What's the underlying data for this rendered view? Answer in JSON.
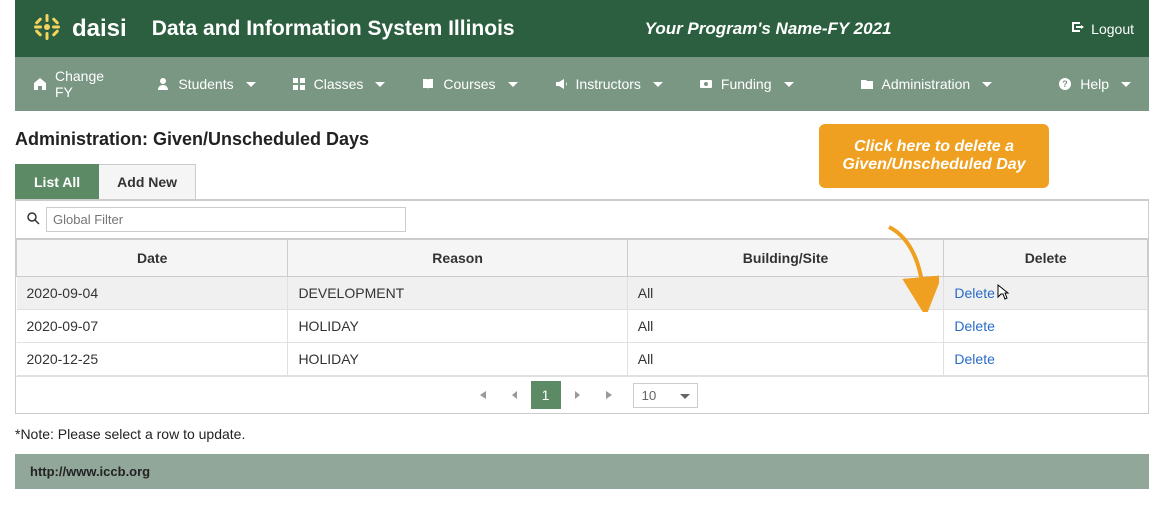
{
  "header": {
    "logo_text": "daisi",
    "system_title": "Data and Information System Illinois",
    "program_name": "Your Program's Name-FY 2021",
    "logout_label": "Logout"
  },
  "nav": {
    "items": [
      {
        "label": "Change FY",
        "icon": "home-icon",
        "has_dropdown": false
      },
      {
        "label": "Students",
        "icon": "person-icon",
        "has_dropdown": true
      },
      {
        "label": "Classes",
        "icon": "grid-icon",
        "has_dropdown": true
      },
      {
        "label": "Courses",
        "icon": "book-icon",
        "has_dropdown": true
      },
      {
        "label": "Instructors",
        "icon": "bullhorn-icon",
        "has_dropdown": true
      },
      {
        "label": "Funding",
        "icon": "money-icon",
        "has_dropdown": true
      },
      {
        "label": "Administration",
        "icon": "folder-icon",
        "has_dropdown": true
      },
      {
        "label": "Help",
        "icon": "question-icon",
        "has_dropdown": true
      }
    ]
  },
  "page": {
    "title": "Administration: Given/Unscheduled Days"
  },
  "tabs": {
    "list_all": "List All",
    "add_new": "Add New"
  },
  "callout": {
    "text": "Click here to delete a Given/Unscheduled Day"
  },
  "filter": {
    "placeholder": "Global Filter"
  },
  "table": {
    "headers": {
      "date": "Date",
      "reason": "Reason",
      "building": "Building/Site",
      "delete": "Delete"
    },
    "rows": [
      {
        "date": "2020-09-04",
        "reason": "DEVELOPMENT",
        "building": "All",
        "delete": "Delete"
      },
      {
        "date": "2020-09-07",
        "reason": "HOLIDAY",
        "building": "All",
        "delete": "Delete"
      },
      {
        "date": "2020-12-25",
        "reason": "HOLIDAY",
        "building": "All",
        "delete": "Delete"
      }
    ]
  },
  "pagination": {
    "current": "1",
    "page_size": "10"
  },
  "note": "*Note: Please select a row to update.",
  "footer": {
    "url": "http://www.iccb.org"
  }
}
